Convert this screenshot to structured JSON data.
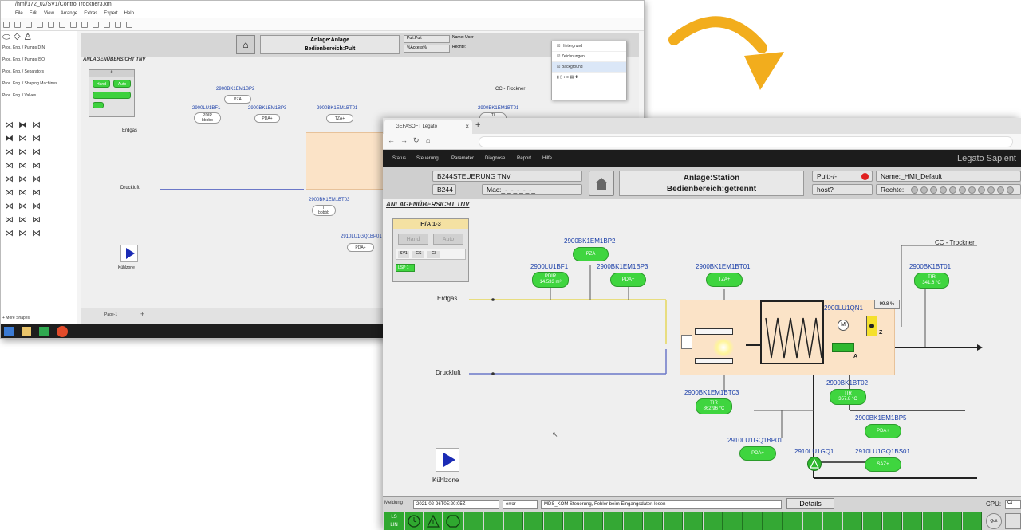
{
  "editor": {
    "title": "/hmi/172_02/SV1/ControlTrockner3.xml",
    "menu": [
      "File",
      "Edit",
      "View",
      "Arrange",
      "Extras",
      "Expert",
      "Help"
    ],
    "shape_libraries": [
      "Proc. Eng. / Pumps DIN",
      "Proc. Eng. / Pumps ISO",
      "Proc. Eng. / Separators",
      "Proc. Eng. / Shaping Machines",
      "Proc. Eng. / Valves"
    ],
    "more_shapes": "+ More Shapes",
    "header": {
      "anlage": "Anlage:Anlage",
      "bedienbereich": "Bedienbereich:Pult",
      "pult": "Pult:Pult",
      "name": "Name: User",
      "rechte": "Rechte:",
      "spacer": "%Access%"
    },
    "overview_title": "ANLAGENÜBERSICHT TNV",
    "ha_title": "#",
    "hand": "Hand",
    "auto": "Auto",
    "tags": {
      "bp2": "2900BK1EM1BP2",
      "bp1": "2900LU1BF1",
      "bp3": "2900BK1EM1BP3",
      "bt01": "2900BK1EM1BT01",
      "bt01b": "2900BK1EM1BT01",
      "bt03": "2900BK1EM1BT03",
      "gq1": "2910LU1GQ1BP01"
    },
    "pills": {
      "pza": "PZA",
      "pdir": "PDIR",
      "pdir_val": "bbbbb",
      "pza2": "PDA+",
      "tza": "TZA+",
      "ti": "TI",
      "ti_val": "bbbbb",
      "pda": "PDA+",
      "pdaplus": "PDA+"
    },
    "erdgas": "Erdgas",
    "druckluft": "Druckluft",
    "kuehlzone": "Kühlzone",
    "cc_trockner": "CC - Trockner",
    "page": "Page-1",
    "layers": [
      "Hintergrund",
      "Zeichnungen",
      "Background"
    ]
  },
  "browser": {
    "tab_title": "GEFASOFT Legato",
    "menu": [
      "Status",
      "Steuerung",
      "Parameter",
      "Diagnose",
      "Report",
      "Hilfe"
    ],
    "logo": "Legato Sapient",
    "header": {
      "station_name": "B244STEUERUNG TNV",
      "station_id": "B244",
      "mac": "Mac:_-_-_-_-_-_",
      "anlage": "Anlage:Station",
      "bedienbereich": "Bedienbereich:getrennt",
      "pult": "Pult:-/-",
      "host": "host?",
      "name": "Name:_HMI_Default",
      "rechte": "Rechte:"
    },
    "overview_title": "ANLAGENÜBERSICHT TNV",
    "ha": {
      "title": "H/A 1-3",
      "hand": "Hand",
      "auto": "Auto",
      "btns": [
        "SV1",
        "-GS",
        "-GI"
      ],
      "status": "LSP 1"
    },
    "tags": {
      "bp2": "2900BK1EM1BP2",
      "bf1": "2900LU1BF1",
      "bp3": "2900BK1EM1BP3",
      "bt01": "2900BK1EM1BT01",
      "cc": "CC - Trockner",
      "bt01r": "2900BK1BT01",
      "qn1": "2900LU1QN1",
      "bt02": "2900BK1BT02",
      "bt03": "2900BK1EM1BT03",
      "bp5": "2900BK1EM1BP5",
      "gq1bp01": "2910LU1GQ1BP01",
      "gq1": "2910LU1GQ1",
      "bs01": "2910LU1GQ1BS01"
    },
    "pills": {
      "pza": "PZA",
      "pdir": "PDIR\n14.533 m³",
      "pda_bp3": "PDA+",
      "tza": "TZA+",
      "ti_right": "TIR\n341.6 °C",
      "ti_bt02": "TIR\n357.8 °C",
      "ti_bt03": "TIR\n862.96 °C",
      "pda_bp5": "PDA+",
      "pda_gq": "PDA+",
      "sas": "SAZ+"
    },
    "percent": "99.8 %",
    "motor": "M",
    "valve_label_a": "A",
    "valve_label_z": "Z",
    "pump_label_a": "A",
    "erdgas": "Erdgas",
    "druckluft": "Druckluft",
    "kuehlzone": "Kühlzone",
    "status": {
      "meldung_label": "Meldung",
      "timestamp": "2021-02-26T05:20:05Z",
      "severity": "error",
      "message": "MDS_KOM Steuerung, Fehler beim Eingangsdaten lesen",
      "details": "Details",
      "cpu": "CPU:",
      "cpu_val": "Ct",
      "ls": "LS",
      "lin": "LIN",
      "quit": "Quit"
    }
  },
  "colors": {
    "green": "#3fd53f",
    "arrow": "#f2ad1d",
    "app_bar": "#1c1c1c",
    "furnace": "#fbe3c7"
  }
}
